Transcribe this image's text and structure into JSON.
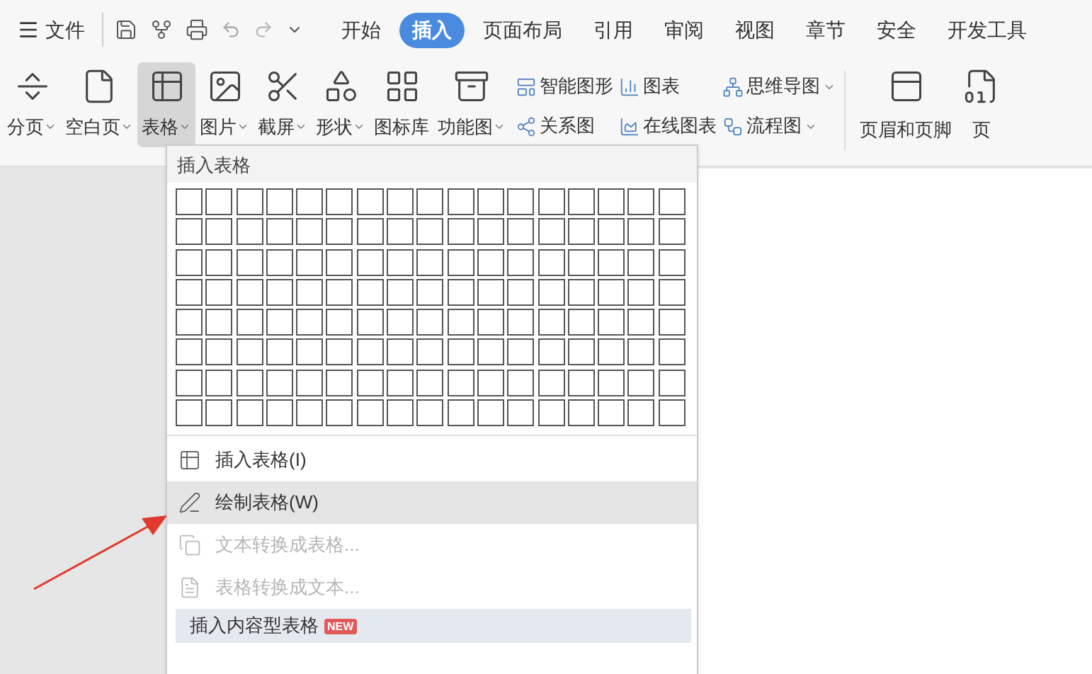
{
  "quick_toolbar": {
    "file_label": "文件",
    "redo_disabled": true
  },
  "menu_tabs": [
    {
      "label": "开始",
      "selected": false
    },
    {
      "label": "插入",
      "selected": true
    },
    {
      "label": "页面布局",
      "selected": false
    },
    {
      "label": "引用",
      "selected": false
    },
    {
      "label": "审阅",
      "selected": false
    },
    {
      "label": "视图",
      "selected": false
    },
    {
      "label": "章节",
      "selected": false
    },
    {
      "label": "安全",
      "selected": false
    },
    {
      "label": "开发工具",
      "selected": false
    }
  ],
  "ribbon_large": [
    {
      "label": "分页",
      "dropdown": true,
      "pressed": false
    },
    {
      "label": "空白页",
      "dropdown": true,
      "pressed": false
    },
    {
      "label": "表格",
      "dropdown": true,
      "pressed": true
    },
    {
      "label": "图片",
      "dropdown": true,
      "pressed": false
    },
    {
      "label": "截屏",
      "dropdown": true,
      "pressed": false
    },
    {
      "label": "形状",
      "dropdown": true,
      "pressed": false
    },
    {
      "label": "图标库",
      "dropdown": false,
      "pressed": false
    },
    {
      "label": "功能图",
      "dropdown": true,
      "pressed": false
    }
  ],
  "ribbon_small": [
    [
      {
        "label": "智能图形",
        "dropdown": false
      },
      {
        "label": "关系图",
        "dropdown": false
      }
    ],
    [
      {
        "label": "图表",
        "dropdown": false
      },
      {
        "label": "在线图表",
        "dropdown": false
      }
    ],
    [
      {
        "label": "思维导图",
        "dropdown": true
      },
      {
        "label": "流程图",
        "dropdown": true
      }
    ]
  ],
  "ribbon_end": [
    {
      "label": "页眉和页脚"
    },
    {
      "label": "页"
    }
  ],
  "table_menu": {
    "title": "插入表格",
    "items": [
      {
        "kind": "item",
        "label": "插入表格(I)",
        "disabled": false,
        "highlighted": false
      },
      {
        "kind": "item",
        "label": "绘制表格(W)",
        "disabled": false,
        "highlighted": true
      },
      {
        "kind": "item",
        "label": "文本转换成表格...",
        "disabled": true,
        "highlighted": false
      },
      {
        "kind": "item",
        "label": "表格转换成文本...",
        "disabled": true,
        "highlighted": false
      },
      {
        "kind": "featured",
        "label": "插入内容型表格",
        "badge": "NEW"
      }
    ]
  }
}
